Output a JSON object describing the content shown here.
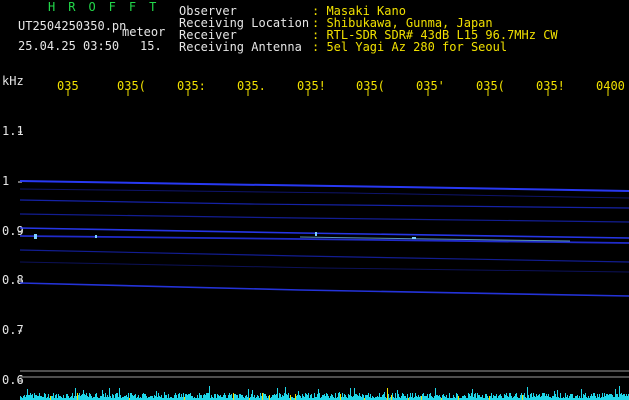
{
  "header": {
    "brand": "HROFFT",
    "filename": "UT2504250350.pn",
    "meteor_label": "meteor",
    "datetime": "25.04.25 03:50",
    "count": "15."
  },
  "info": {
    "observer_label": "Observer",
    "observer_value": ": Masaki Kano",
    "location_label": "Receiving Location",
    "location_value": ": Shibukawa, Gunma, Japan",
    "receiver_label": "Receiver",
    "receiver_value": ": RTL-SDR SDR# 43dB L15 96.7MHz CW",
    "antenna_label": "Receiving Antenna",
    "antenna_value": ": 5el Yagi Az 280 for Seoul"
  },
  "axis": {
    "unit": "kHz",
    "x_ticks": [
      "035",
      "035(",
      "035:",
      "035.",
      "035!",
      "035(",
      "035'",
      "035(",
      "035!",
      "0400"
    ],
    "y_ticks": [
      "1.1",
      "1",
      "0.9",
      "0.8",
      "0.7",
      "0.6"
    ]
  },
  "colors": {
    "background": "#000000",
    "label_text": "#e6e6e6",
    "value_text": "#f0e000",
    "brand_text": "#22d84a",
    "signal": "#2a3cff",
    "signal_bright": "#7fd0ff",
    "grid_line": "#9a9a9a",
    "noise": "#1fd6e8"
  }
}
